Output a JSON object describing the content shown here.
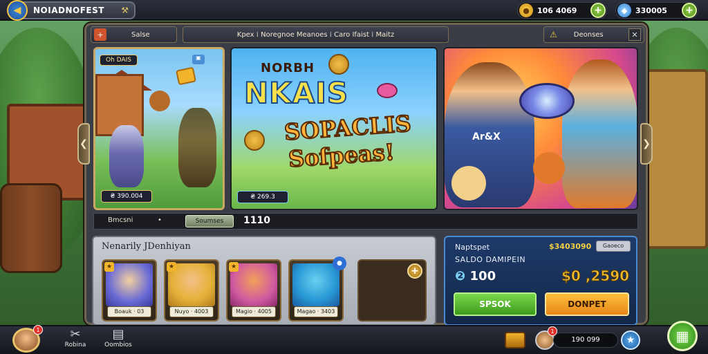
{
  "header": {
    "title": "NOIADNOFEST",
    "back_icon": "◀",
    "tool_icon": "⚒",
    "currency": [
      {
        "icon": "gold-coin",
        "value": "106 4069",
        "add_label": "+"
      },
      {
        "icon": "blue-gem",
        "value": "330005",
        "add_label": "+"
      }
    ]
  },
  "tabs": {
    "home_icon": "+",
    "home_label": "Salse",
    "center_label": "Kpex  ⁞  Noregnoe Meanoes  ⁞  Caro  Ifaist  ⁞  Maitz",
    "right_label": "Deonses",
    "right_warn": "⚠",
    "close": "✕"
  },
  "carousel": {
    "prev": "❮",
    "next": "❯",
    "banner1": {
      "tag": "Oh  DAIS",
      "score": "₴ 390.004"
    },
    "banner2": {
      "title_small": "NORBH",
      "title_big": "NKAIS",
      "subtitle1": "SOPACLIS",
      "subtitle2": "Sofpeas!",
      "score": "₴ 269.3"
    },
    "banner3": {
      "shirt": "Ar&X"
    }
  },
  "underbar": {
    "label": "Bmcsni",
    "tiny": "•",
    "button": "Soumses",
    "number": "1110"
  },
  "inventory": {
    "title": "Nenarily JDenhiyan",
    "cards": [
      {
        "caption": "Boauk  ·  03",
        "corner": "★"
      },
      {
        "caption": "Nuyo  ·  4003",
        "corner": "★"
      },
      {
        "caption": "Magio  ·  4005",
        "corner": "★"
      },
      {
        "caption": "Magao  ·  3403",
        "corner": "●"
      }
    ],
    "add_label": "+"
  },
  "balance": {
    "label": "Naptspet",
    "gold": "$3403090",
    "chip": "Gaoeco",
    "sub": "SALDO DAMIPEIN",
    "left_icon": "❷",
    "left_value": "100",
    "right_value": "$0 ,2590",
    "green_button": "SPSOK",
    "orange_button": "DONPET"
  },
  "bottom": {
    "avatar_badge": "1",
    "nav": [
      {
        "icon": "✂",
        "label": "Robina"
      },
      {
        "icon": "▤",
        "label": "Oombios"
      }
    ],
    "count_badge": "1",
    "count": "190 099",
    "star": "★",
    "grid_icon": "▦"
  }
}
